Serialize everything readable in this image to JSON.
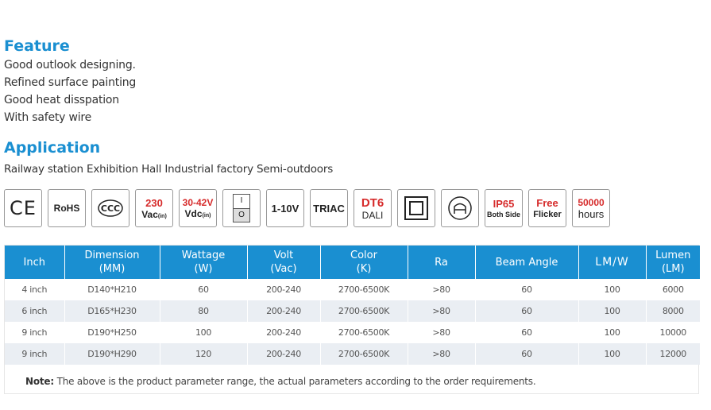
{
  "feature": {
    "title": "Feature",
    "lines": [
      "Good outlook designing.",
      "Refined surface painting",
      "Good heat disspation",
      "With safety wire"
    ]
  },
  "application": {
    "title": "Application",
    "text": "Railway station Exhibition Hall Industrial factory Semi-outdoors"
  },
  "badges": {
    "ce": "CE",
    "rohs": "RoHS",
    "ccc": "CCC",
    "vac_value": "230",
    "vac_label": "Vac",
    "vac_sub": "(in)",
    "vdc_value": "30-42V",
    "vdc_label": "Vdc",
    "vdc_sub": "(in)",
    "switch_on": "I",
    "switch_off": "O",
    "dimming": "1-10V",
    "triac": "TRIAC",
    "dt6": "DT6",
    "dali": "DALI",
    "ip65": "IP65",
    "ip65_sub": "Both Side",
    "free": "Free",
    "flicker": "Flicker",
    "hours_value": "50000",
    "hours_label": "hours"
  },
  "table": {
    "headers": [
      {
        "l1": "Inch",
        "l2": ""
      },
      {
        "l1": "Dimension",
        "l2": "(MM)"
      },
      {
        "l1": "Wattage",
        "l2": "(W)"
      },
      {
        "l1": "Volt",
        "l2": "(Vac)"
      },
      {
        "l1": "Color",
        "l2": "(K)"
      },
      {
        "l1": "Ra",
        "l2": ""
      },
      {
        "l1": "Beam Angle",
        "l2": ""
      },
      {
        "l1": "LM/W",
        "l2": ""
      },
      {
        "l1": "Lumen",
        "l2": "(LM)"
      }
    ],
    "rows": [
      [
        "4 inch",
        "D140*H210",
        "60",
        "200-240",
        "2700-6500K",
        ">80",
        "60",
        "100",
        "6000"
      ],
      [
        "6 inch",
        "D165*H230",
        "80",
        "200-240",
        "2700-6500K",
        ">80",
        "60",
        "100",
        "8000"
      ],
      [
        "9 inch",
        "D190*H250",
        "100",
        "200-240",
        "2700-6500K",
        ">80",
        "60",
        "100",
        "10000"
      ],
      [
        "9 inch",
        "D190*H290",
        "120",
        "200-240",
        "2700-6500K",
        ">80",
        "60",
        "100",
        "12000"
      ]
    ],
    "note_label": "Note:",
    "note_text": " The above is the product parameter range, the actual parameters according to the order requirements."
  },
  "colors": {
    "accent": "#1a8fd1",
    "badge_red": "#d62b2b",
    "row_alt": "#eaeef3"
  }
}
